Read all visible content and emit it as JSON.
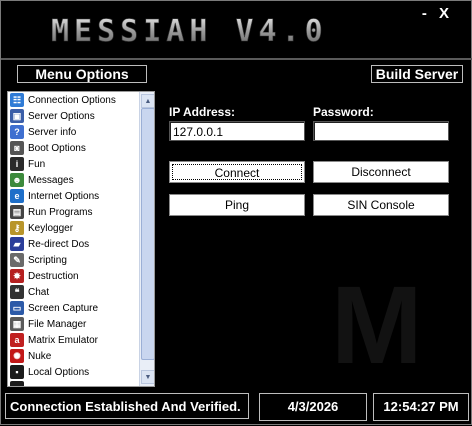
{
  "window": {
    "title": "MESSIAH V4.0",
    "minimize": "-",
    "close": "X"
  },
  "header": {
    "menu_options": "Menu Options",
    "build_server": "Build Server"
  },
  "menu": {
    "items": [
      {
        "label": "Connection Options",
        "icon": "network-icon",
        "color": "#2f7bd6",
        "glyph": "☷"
      },
      {
        "label": "Server Options",
        "icon": "computer-icon",
        "color": "#3b5ea8",
        "glyph": "▣"
      },
      {
        "label": "Server info",
        "icon": "help-icon",
        "color": "#3f6fd0",
        "glyph": "?"
      },
      {
        "label": "Boot Options",
        "icon": "boot-icon",
        "color": "#555555",
        "glyph": "◙"
      },
      {
        "label": "Fun",
        "icon": "info-icon",
        "color": "#2a2a2a",
        "glyph": "i"
      },
      {
        "label": "Messages",
        "icon": "user-icon",
        "color": "#3c8a3c",
        "glyph": "☻"
      },
      {
        "label": "Internet Options",
        "icon": "globe-icon",
        "color": "#1e6fc9",
        "glyph": "e"
      },
      {
        "label": "Run Programs",
        "icon": "floppy-icon",
        "color": "#444444",
        "glyph": "▤"
      },
      {
        "label": "Keylogger",
        "icon": "key-icon",
        "color": "#b8952b",
        "glyph": "⚷"
      },
      {
        "label": "Re-direct Dos",
        "icon": "book-icon",
        "color": "#2a3d9a",
        "glyph": "▰"
      },
      {
        "label": "Scripting",
        "icon": "script-icon",
        "color": "#6a6a6a",
        "glyph": "✎"
      },
      {
        "label": "Destruction",
        "icon": "explosion-icon",
        "color": "#b52020",
        "glyph": "✸"
      },
      {
        "label": "Chat",
        "icon": "chat-icon",
        "color": "#333333",
        "glyph": "❝"
      },
      {
        "label": "Screen Capture",
        "icon": "monitor-icon",
        "color": "#2c5aa8",
        "glyph": "▭"
      },
      {
        "label": "File Manager",
        "icon": "folder-icon",
        "color": "#5a5a5a",
        "glyph": "▦"
      },
      {
        "label": "Matrix Emulator",
        "icon": "matrix-icon",
        "color": "#c02020",
        "glyph": "a"
      },
      {
        "label": "Nuke",
        "icon": "nuke-icon",
        "color": "#c21818",
        "glyph": "✺"
      },
      {
        "label": "Local Options",
        "icon": "local-icon",
        "color": "#1b1b1b",
        "glyph": "▪"
      },
      {
        "label": "",
        "icon": "more-icon",
        "color": "#1b1b1b",
        "glyph": "▪"
      }
    ]
  },
  "connection": {
    "ip_label": "IP Address:",
    "ip_value": "127.0.0.1",
    "password_label": "Password:",
    "password_value": "",
    "connect": "Connect",
    "disconnect": "Disconnect",
    "ping": "Ping",
    "sin_console": "SIN Console"
  },
  "status": {
    "message": "Connection Established And Verified.",
    "date": "4/3/2026",
    "time": "12:54:27 PM"
  },
  "colors": {
    "background": "#000000",
    "text": "#ffffff",
    "border": "#bdbdbd"
  }
}
